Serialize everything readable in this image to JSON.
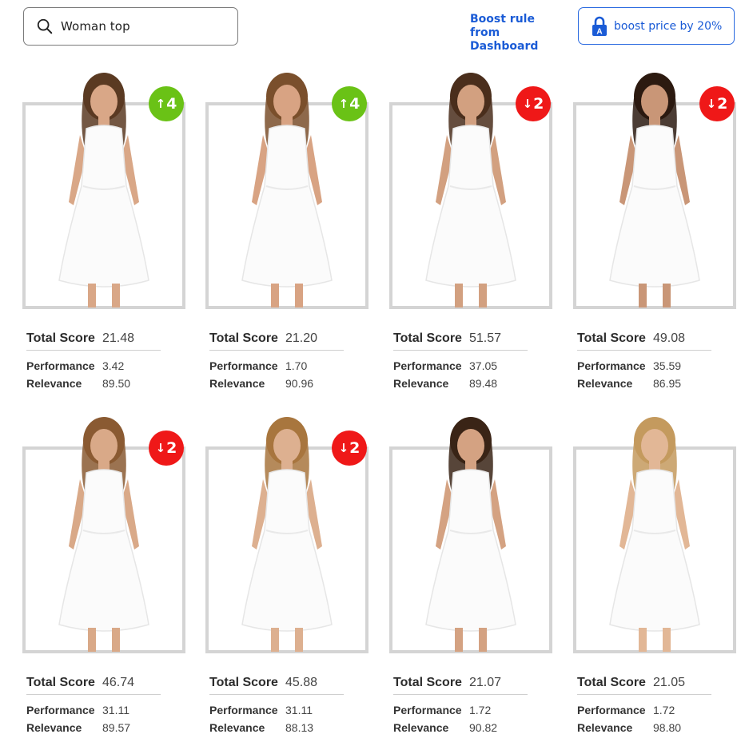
{
  "search": {
    "query": "Woman top",
    "icon": "search-icon"
  },
  "toolbar": {
    "boost_rule_line1": "Boost rule",
    "boost_rule_line2": "from Dashboard",
    "boost_button_label": "boost price by 20%",
    "boost_icon": "lock-icon",
    "accent": "#1a5bd6"
  },
  "labels": {
    "total": "Total Score",
    "performance": "Performance",
    "relevance": "Relevance"
  },
  "colors": {
    "up": "#6ac216",
    "down": "#ef1818",
    "frame": "#d4d4d4"
  },
  "products": [
    {
      "badge": "4",
      "direction": "up",
      "total": "21.48",
      "performance": "3.42",
      "relevance": "89.50"
    },
    {
      "badge": "4",
      "direction": "up",
      "total": "21.20",
      "performance": "1.70",
      "relevance": "90.96"
    },
    {
      "badge": "2",
      "direction": "down",
      "total": "51.57",
      "performance": "37.05",
      "relevance": "89.48"
    },
    {
      "badge": "2",
      "direction": "down",
      "total": "49.08",
      "performance": "35.59",
      "relevance": "86.95"
    },
    {
      "badge": "2",
      "direction": "down",
      "total": "46.74",
      "performance": "31.11",
      "relevance": "89.57"
    },
    {
      "badge": "2",
      "direction": "down",
      "total": "45.88",
      "performance": "31.11",
      "relevance": "88.13"
    },
    {
      "badge": "",
      "direction": "",
      "total": "21.07",
      "performance": "1.72",
      "relevance": "90.82"
    },
    {
      "badge": "",
      "direction": "",
      "total": "21.05",
      "performance": "1.72",
      "relevance": "98.80"
    }
  ]
}
